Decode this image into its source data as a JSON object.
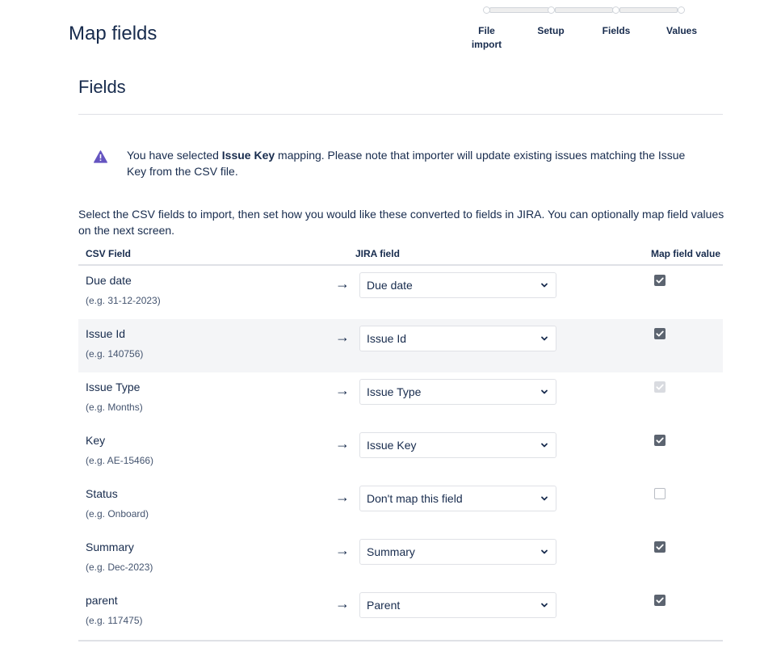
{
  "header": {
    "title": "Map fields"
  },
  "progress": {
    "steps": [
      "File import",
      "Setup",
      "Fields",
      "Values"
    ]
  },
  "section": {
    "title": "Fields"
  },
  "warning": {
    "prefix": "You have selected ",
    "bold": "Issue Key",
    "suffix": " mapping. Please note that importer will update existing issues matching the Issue Key from the CSV file."
  },
  "intro": "Select the CSV fields to import, then set how you would like these converted to fields in JIRA. You can optionally map field values on the next screen.",
  "table": {
    "headers": {
      "csv": "CSV Field",
      "jira": "JIRA field",
      "map": "Map field value"
    },
    "arrow": "→",
    "rows": [
      {
        "csv": "Due date",
        "example": "(e.g. 31-12-2023)",
        "jira": "Due date",
        "map_checked": true,
        "map_disabled": false
      },
      {
        "csv": "Issue Id",
        "example": "(e.g. 140756)",
        "jira": "Issue Id",
        "map_checked": true,
        "map_disabled": false
      },
      {
        "csv": "Issue Type",
        "example": "(e.g. Months)",
        "jira": "Issue Type",
        "map_checked": true,
        "map_disabled": true
      },
      {
        "csv": "Key",
        "example": "(e.g. AE-15466)",
        "jira": "Issue Key",
        "map_checked": true,
        "map_disabled": false
      },
      {
        "csv": "Status",
        "example": "(e.g. Onboard)",
        "jira": "Don't map this field",
        "map_checked": false,
        "map_disabled": true
      },
      {
        "csv": "Summary",
        "example": "(e.g. Dec-2023)",
        "jira": "Summary",
        "map_checked": true,
        "map_disabled": false
      },
      {
        "csv": "parent",
        "example": "(e.g. 117475)",
        "jira": "Parent",
        "map_checked": true,
        "map_disabled": false
      }
    ]
  },
  "colors": {
    "text": "#172b4d",
    "warning_icon": "#6554c0",
    "row_alt": "#f4f5f7",
    "checkbox": "#5c6470"
  }
}
